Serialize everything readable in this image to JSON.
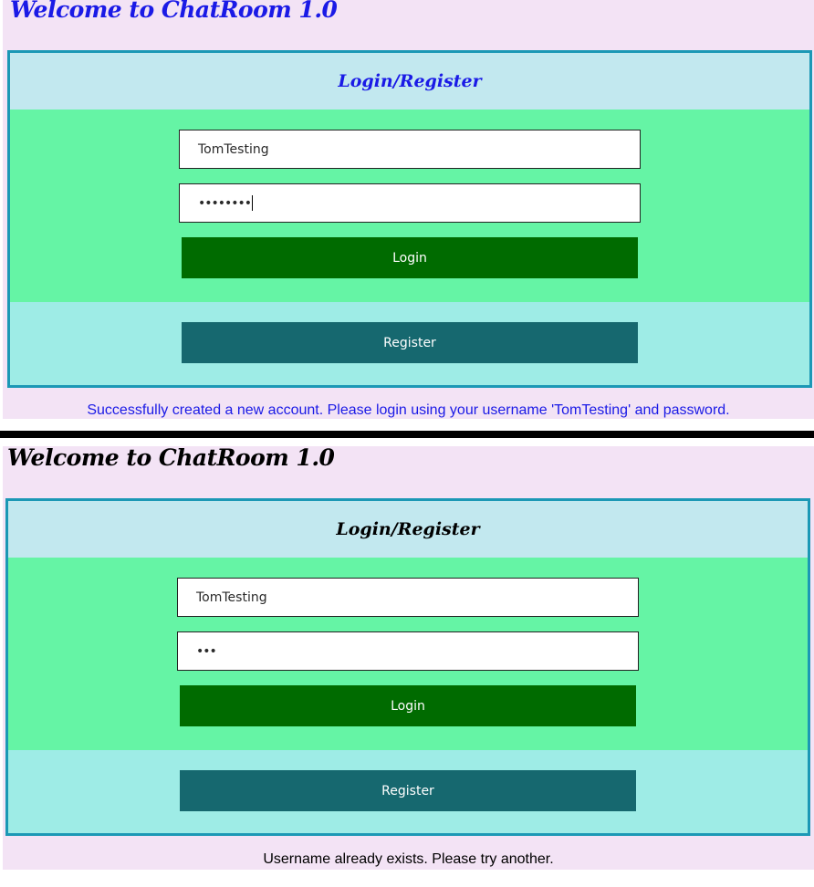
{
  "screen1": {
    "title": "Welcome to ChatRoom 1.0",
    "header": "Login/Register",
    "username": "TomTesting",
    "password_masked": "••••••••",
    "login_label": "Login",
    "register_label": "Register",
    "message": "Successfully created a new account. Please login using your username 'TomTesting' and password.",
    "title_color": "#1a1ae6",
    "message_color": "#1a1ae6"
  },
  "screen2": {
    "title": "Welcome to ChatRoom 1.0",
    "header": "Login/Register",
    "username": "TomTesting",
    "password_masked": "•••",
    "login_label": "Login",
    "register_label": "Register",
    "message": "Username already exists. Please try another.",
    "title_color": "#000000",
    "message_color": "#000000"
  },
  "colors": {
    "page_background": "#f3e3f5",
    "card_border": "#1b98b5",
    "card_header": "#c2e8ef",
    "login_zone": "#65f4a5",
    "register_zone": "#9eece6",
    "login_button": "#006b00",
    "register_button": "#16686f",
    "divider": "#000000"
  }
}
